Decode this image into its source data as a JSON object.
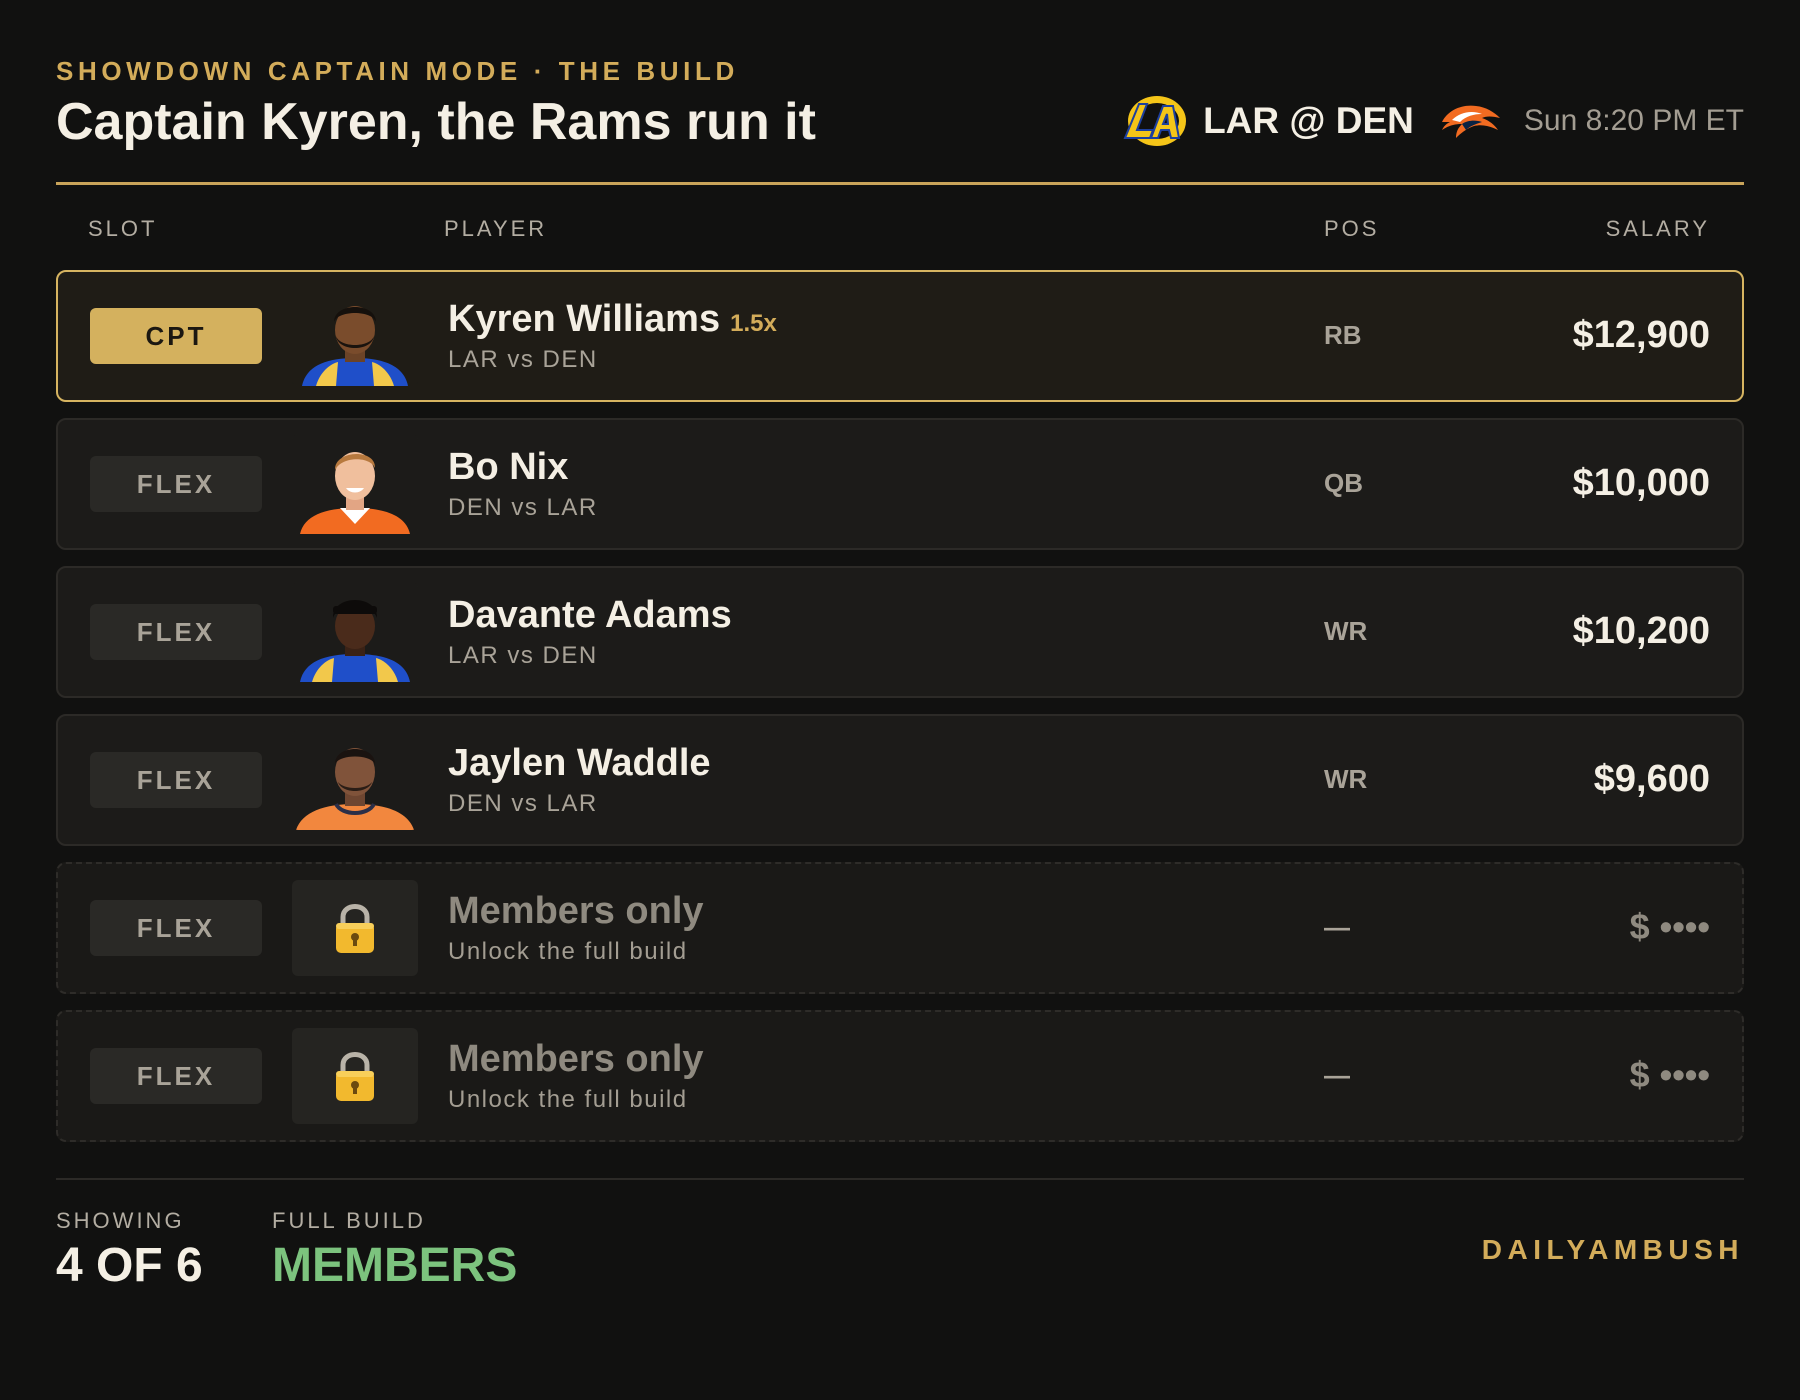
{
  "header": {
    "eyebrow": "SHOWDOWN CAPTAIN MODE · THE BUILD",
    "title": "Captain Kyren, the Rams run it",
    "matchup": "LAR @ DEN",
    "kickoff": "Sun 8:20 PM ET",
    "away_logo_icon": "rams-logo-icon",
    "home_logo_icon": "broncos-logo-icon"
  },
  "columns": {
    "slot": "SLOT",
    "player": "PLAYER",
    "pos": "POS",
    "salary": "SALARY"
  },
  "rows": [
    {
      "slot": "CPT",
      "name": "Kyren Williams",
      "multiplier": "1.5x",
      "matchup": "LAR vs DEN",
      "pos": "RB",
      "salary": "$12,900"
    },
    {
      "slot": "FLEX",
      "name": "Bo Nix",
      "matchup": "DEN vs LAR",
      "pos": "QB",
      "salary": "$10,000"
    },
    {
      "slot": "FLEX",
      "name": "Davante Adams",
      "matchup": "LAR vs DEN",
      "pos": "WR",
      "salary": "$10,200"
    },
    {
      "slot": "FLEX",
      "name": "Jaylen Waddle",
      "matchup": "DEN vs LAR",
      "pos": "WR",
      "salary": "$9,600"
    },
    {
      "slot": "FLEX",
      "name": "Members only",
      "matchup": "Unlock the full build",
      "pos": "—",
      "salary": "$ ••••"
    },
    {
      "slot": "FLEX",
      "name": "Members only",
      "matchup": "Unlock the full build",
      "pos": "—",
      "salary": "$ ••••"
    }
  ],
  "footer": {
    "showing_label": "SHOWING",
    "showing_value": "4 OF 6",
    "full_label": "FULL BUILD",
    "full_value": "MEMBERS",
    "brand": "DAILYAMBUSH"
  },
  "colors": {
    "accent_gold": "#d3ac5a",
    "members_green": "#7cc37e",
    "background": "#111110",
    "rams_blue": "#1d4fc4",
    "broncos_orange": "#f26b21"
  }
}
